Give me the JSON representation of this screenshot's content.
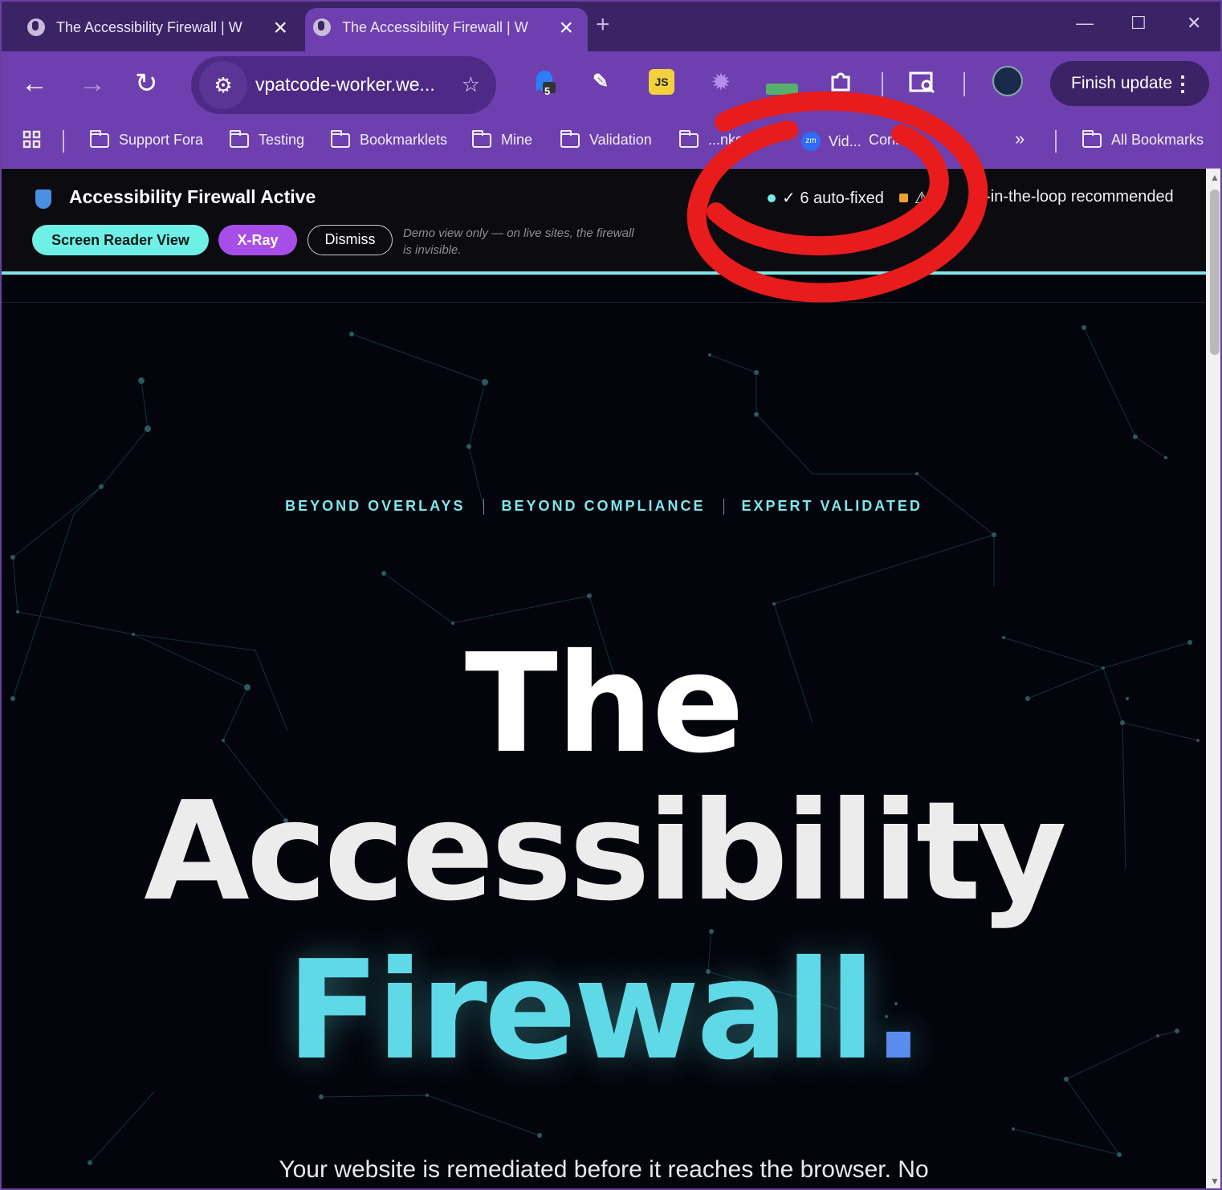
{
  "browser": {
    "tabs": [
      {
        "title": "The Accessibility Firewall | W",
        "close_icon": "×"
      },
      {
        "title": "The Accessibility Firewall | W",
        "close_icon": "×"
      }
    ],
    "new_tab": "+",
    "window_controls": {
      "minimize": "—",
      "maximize": "☐",
      "close": "✕"
    },
    "toolbar": {
      "back": "←",
      "forward": "→",
      "reload": "↻",
      "url": "vpatcode-worker.we...",
      "bookmark_star": "☆",
      "extension_badge": "5",
      "js_extension": "JS",
      "finish_update": "Finish update",
      "menu_dots": "⋮"
    },
    "bookmarks": {
      "apps_icon": "apps-grid-icon",
      "items": [
        "Support Fora",
        "Testing",
        "Bookmarklets",
        "Mine",
        "Validation",
        "...nks",
        "Vid...",
        "Confer..."
      ],
      "overflow": "»",
      "all_bookmarks": "All Bookmarks"
    }
  },
  "firewall_bar": {
    "title": "Accessibility Firewall Active",
    "buttons": {
      "screen_reader": "Screen Reader View",
      "xray": "X-Ray",
      "dismiss": "Dismiss"
    },
    "demo_note": "Demo view only — on live sites, the firewall is invisible.",
    "status_fixed": "✓ 6 auto-fixed",
    "status_warning": "⚠ (",
    "status_human": "n-in-the-loop recommended",
    "colors": {
      "fixed_dot": "#6ff0e6",
      "warning_square": "#f0a030"
    }
  },
  "hero": {
    "taglines": [
      "BEYOND OVERLAYS",
      "BEYOND COMPLIANCE",
      "EXPERT VALIDATED"
    ],
    "title_line1": "The",
    "title_line2": "Accessibility",
    "title_line3": "Firewall",
    "title_period": ".",
    "subhead": "Your website is remediated before it reaches the browser. No"
  },
  "colors": {
    "browser_frame": "#6e3fae",
    "page_background": "#04050c",
    "accent_teal": "#6ff0e6",
    "accent_purple": "#a84ee8",
    "annotation_red": "#e81c1c"
  }
}
